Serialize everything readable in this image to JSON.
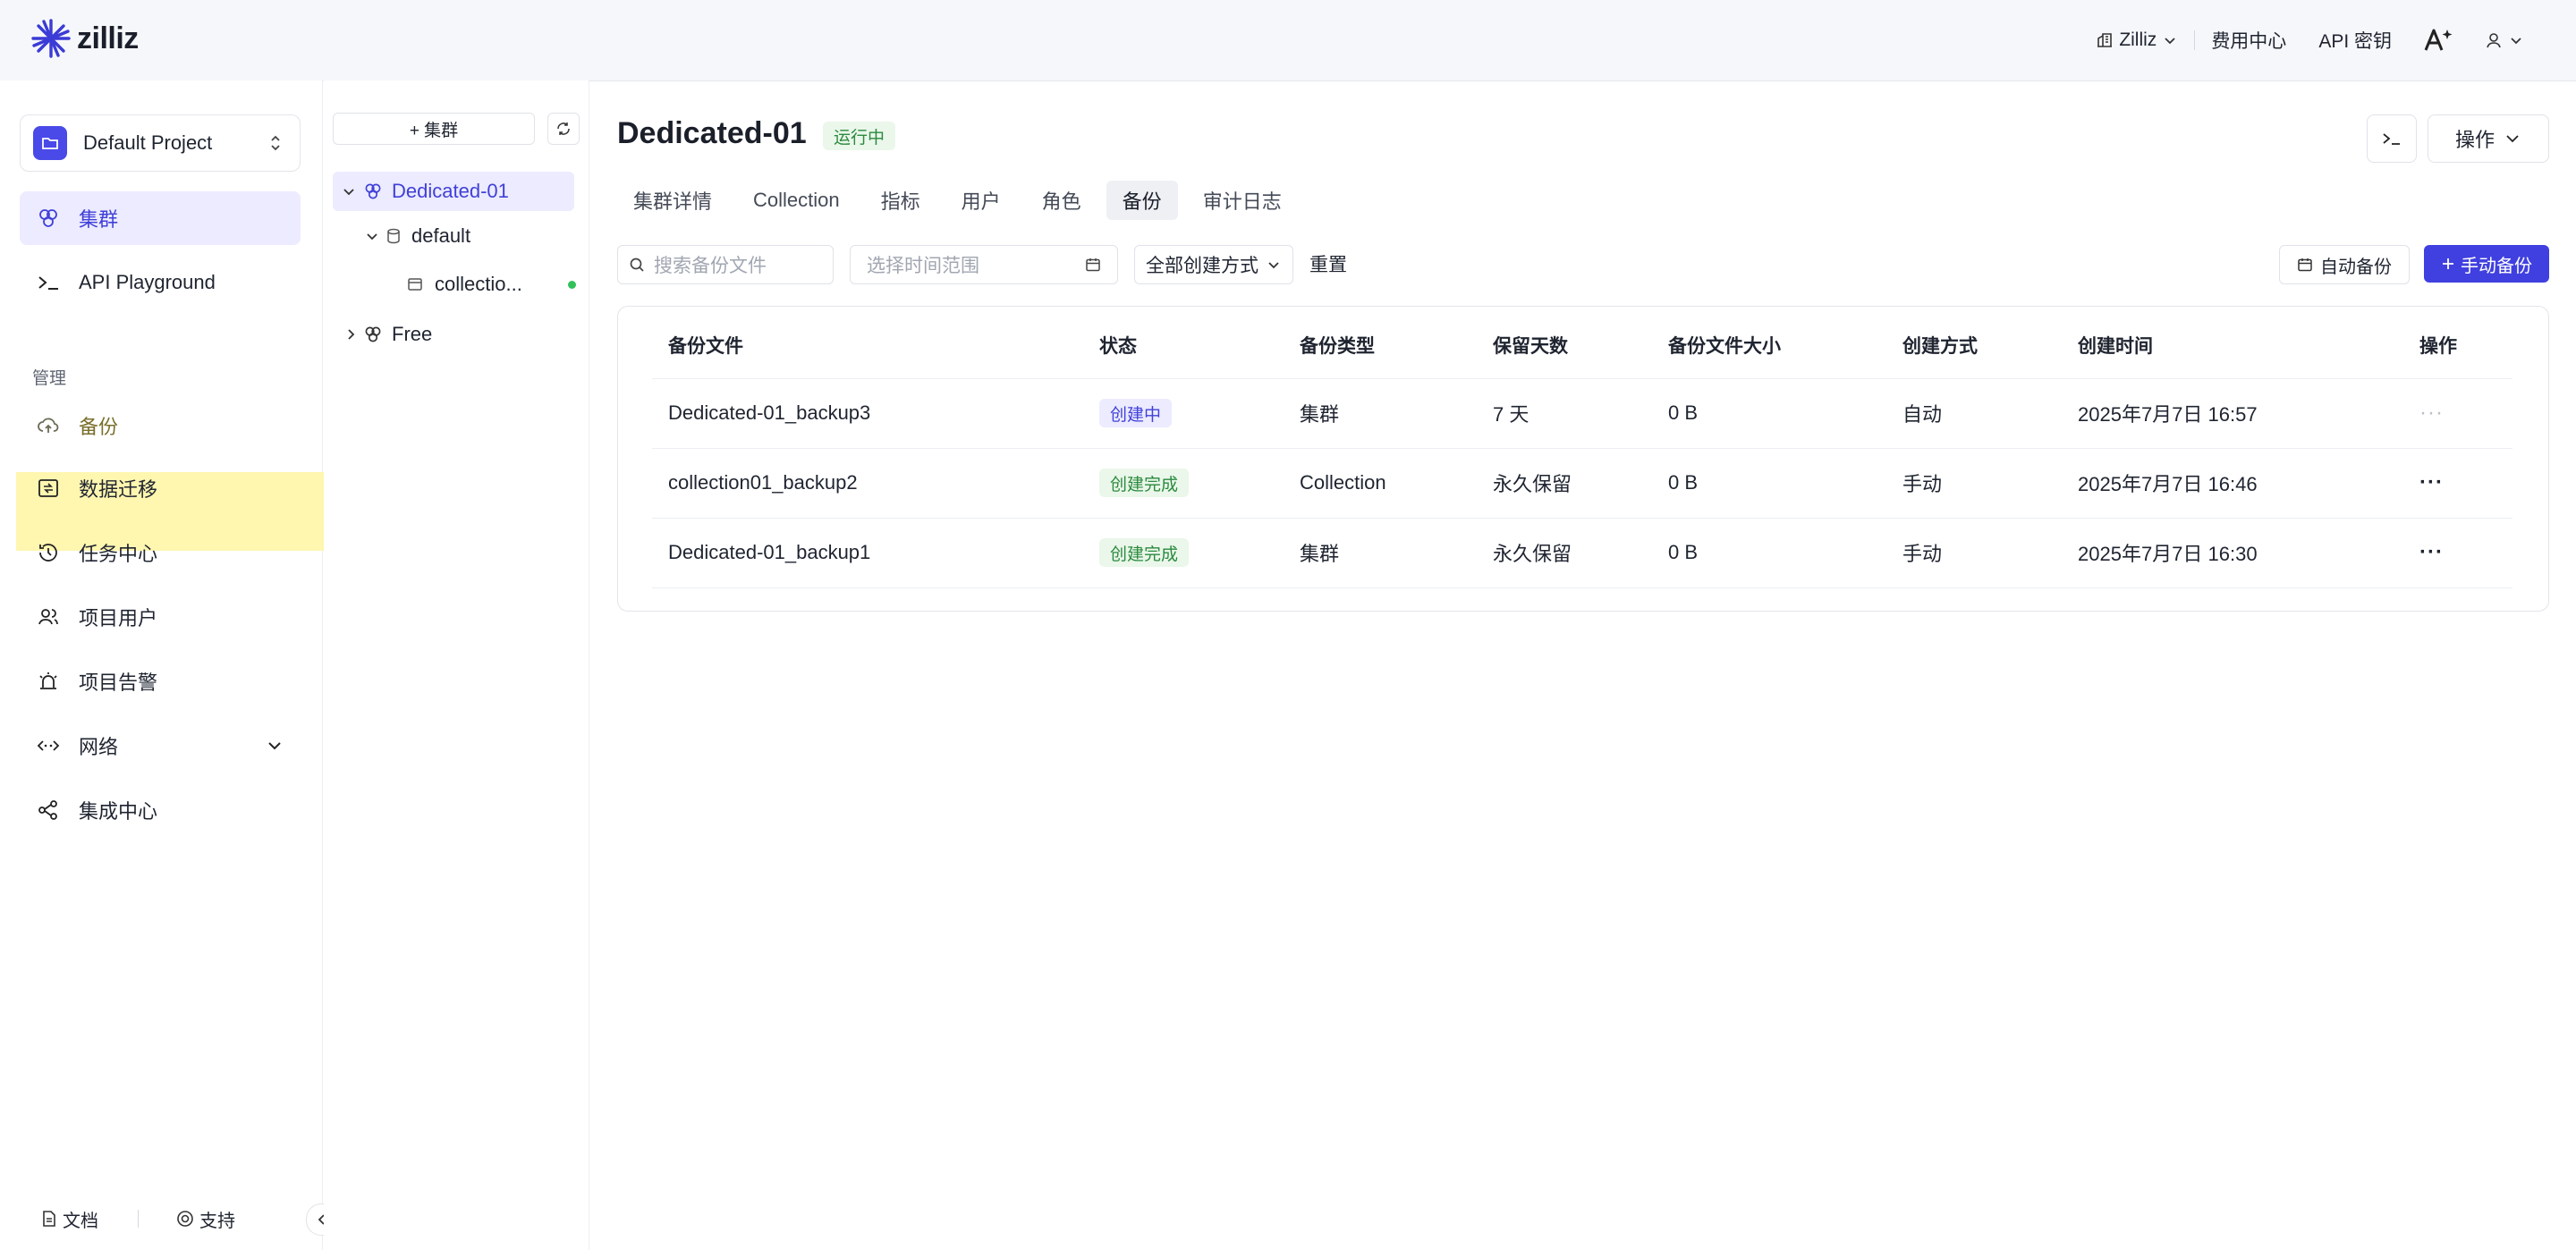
{
  "topbar": {
    "logo_text": "zilliz",
    "org_label": "Zilliz",
    "billing_label": "费用中心",
    "api_key_label": "API 密钥"
  },
  "sidebar": {
    "project_name": "Default Project",
    "items": [
      {
        "label": "集群",
        "icon": "cluster-icon",
        "active": true
      },
      {
        "label": "API Playground",
        "icon": "terminal-icon"
      }
    ],
    "section_label": "管理",
    "manage_items": [
      {
        "label": "备份",
        "icon": "cloud-upload-icon"
      },
      {
        "label": "数据迁移",
        "icon": "migration-icon"
      },
      {
        "label": "任务中心",
        "icon": "history-icon"
      },
      {
        "label": "项目用户",
        "icon": "users-icon"
      },
      {
        "label": "项目告警",
        "icon": "alarm-icon"
      },
      {
        "label": "网络",
        "icon": "network-icon"
      },
      {
        "label": "集成中心",
        "icon": "share-icon"
      }
    ],
    "footer": {
      "docs_label": "文档",
      "support_label": "支持"
    }
  },
  "tree": {
    "add_cluster_label": "+ 集群",
    "nodes": {
      "cluster1": "Dedicated-01",
      "db": "default",
      "collection": "collectio...",
      "cluster2": "Free"
    }
  },
  "main": {
    "title": "Dedicated-01",
    "status": "运行中",
    "ops_label": "操作",
    "tabs": [
      "集群详情",
      "Collection",
      "指标",
      "用户",
      "角色",
      "备份",
      "审计日志"
    ],
    "active_tab": "备份",
    "filters": {
      "search_placeholder": "搜索备份文件",
      "date_placeholder": "选择时间范围",
      "creation_select": "全部创建方式",
      "reset_label": "重置"
    },
    "auto_backup_label": "自动备份",
    "manual_backup_label": "手动备份",
    "table": {
      "headers": [
        "备份文件",
        "状态",
        "备份类型",
        "保留天数",
        "备份文件大小",
        "创建方式",
        "创建时间",
        "操作"
      ],
      "rows": [
        {
          "name": "Dedicated-01_backup3",
          "status": "创建中",
          "type": "集群",
          "retention": "7 天",
          "size": "0 B",
          "method": "自动",
          "created": "2025年7月7日 16:57",
          "ops": "···"
        },
        {
          "name": "collection01_backup2",
          "status": "创建完成",
          "type": "Collection",
          "retention": "永久保留",
          "size": "0 B",
          "method": "手动",
          "created": "2025年7月7日 16:46",
          "ops": "···"
        },
        {
          "name": "Dedicated-01_backup1",
          "status": "创建完成",
          "type": "集群",
          "retention": "永久保留",
          "size": "0 B",
          "method": "手动",
          "created": "2025年7月7日 16:30",
          "ops": "···"
        }
      ]
    }
  },
  "colors": {
    "accent": "#4040e0",
    "success": "#2b8a3e",
    "highlight": "#fff6b0"
  }
}
